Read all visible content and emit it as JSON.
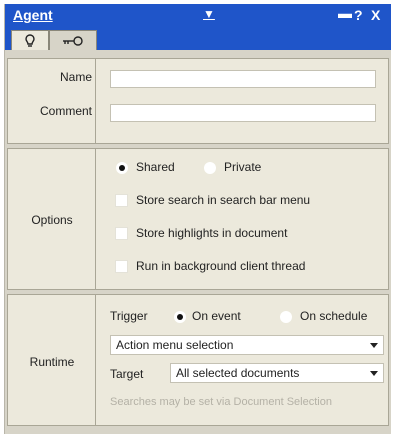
{
  "titlebar": {
    "title": "Agent",
    "minimize_glyph": "▬",
    "help_glyph": "?",
    "close_glyph": "X"
  },
  "tabs": [
    {
      "icon": "search-bulb-icon",
      "selected": true
    },
    {
      "icon": "key-icon",
      "selected": false
    }
  ],
  "identity": {
    "name_label": "Name",
    "name_value": "",
    "comment_label": "Comment",
    "comment_value": ""
  },
  "options": {
    "label": "Options",
    "shared_label": "Shared",
    "private_label": "Private",
    "shared_selected": true,
    "checkboxes": [
      {
        "label": "Store search in search bar menu",
        "checked": false
      },
      {
        "label": "Store highlights in document",
        "checked": false
      },
      {
        "label": "Run in background client thread",
        "checked": false
      }
    ]
  },
  "runtime": {
    "label": "Runtime",
    "trigger_label": "Trigger",
    "on_event_label": "On event",
    "on_schedule_label": "On schedule",
    "on_event_selected": true,
    "action_value": "Action menu selection",
    "target_label": "Target",
    "target_value": "All selected documents",
    "hint": "Searches may be set via Document Selection"
  },
  "colors": {
    "titlebar": "#1f55c9",
    "panel": "#d7d4c8",
    "section": "#ece9dc"
  }
}
